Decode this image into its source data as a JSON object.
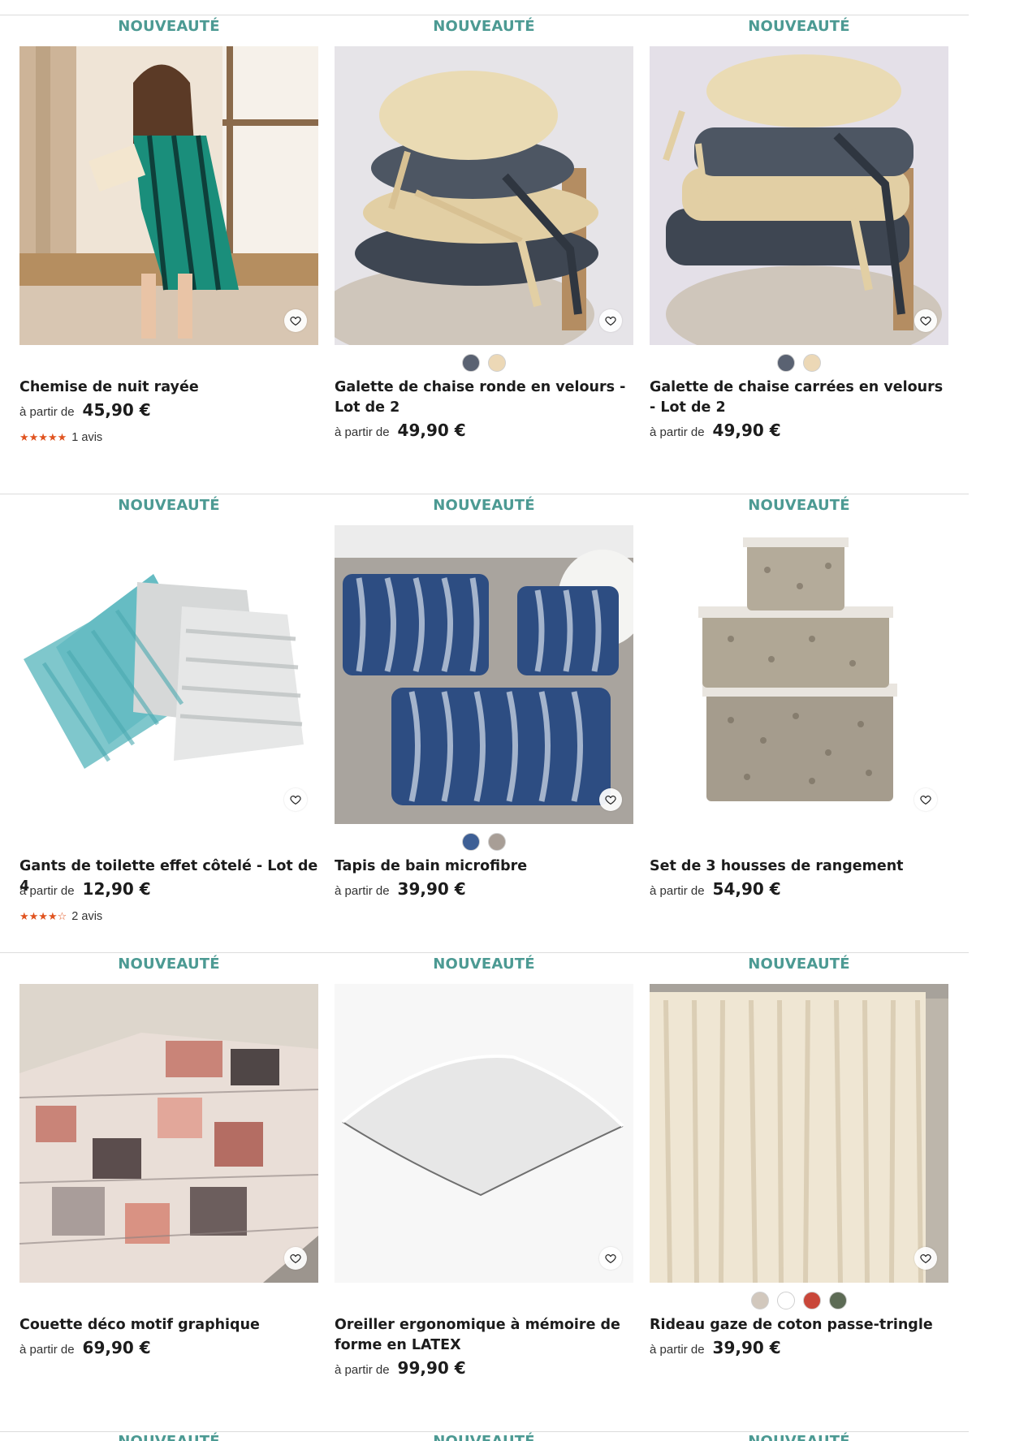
{
  "products": [
    {
      "badge": "NOUVEAUTÉ",
      "title": "Chemise de nuit rayée",
      "price_prefix": "à partir de",
      "price": "45,90 €",
      "rating_stars": "★★★★★",
      "rating_text": "1 avis",
      "image": "woman-nightshirt-photo",
      "swatches": []
    },
    {
      "badge": "NOUVEAUTÉ",
      "title": "Galette de chaise ronde en velours - Lot de 2",
      "price_prefix": "à partir de",
      "price": "49,90 €",
      "image": "round-velvet-cushions-photo",
      "swatches": [
        "#5a6272",
        "#ecd8b6"
      ]
    },
    {
      "badge": "NOUVEAUTÉ",
      "title": "Galette de chaise carrées en velours - Lot de 2",
      "price_prefix": "à partir de",
      "price": "49,90 €",
      "image": "square-velvet-cushions-photo",
      "swatches": [
        "#5a6272",
        "#ecd8b6"
      ]
    },
    {
      "badge": "NOUVEAUTÉ",
      "title": "Gants de toilette effet côtelé - Lot de 4",
      "price_prefix": "à partir de",
      "price": "12,90 €",
      "rating_stars": "★★★★☆",
      "rating_text": "2 avis",
      "image": "ribbed-washcloths-photo",
      "swatches": []
    },
    {
      "badge": "NOUVEAUTÉ",
      "title": "Tapis de bain microfibre",
      "price_prefix": "à partir de",
      "price": "39,90 €",
      "image": "bath-mats-photo",
      "swatches": [
        "#3e5f95",
        "#a89e96"
      ]
    },
    {
      "badge": "NOUVEAUTÉ",
      "title": "Set de 3 housses de rangement",
      "price_prefix": "à partir de",
      "price": "54,90 €",
      "image": "storage-boxes-photo",
      "swatches": []
    },
    {
      "badge": "NOUVEAUTÉ",
      "title": "Couette déco motif graphique",
      "price_prefix": "à partir de",
      "price": "69,90 €",
      "image": "graphic-duvet-photo",
      "swatches": []
    },
    {
      "badge": "NOUVEAUTÉ",
      "title": "Oreiller ergonomique à mémoire de forme en LATEX",
      "price_prefix": "à partir de",
      "price": "99,90 €",
      "image": "memory-foam-pillow-photo",
      "swatches": []
    },
    {
      "badge": "NOUVEAUTÉ",
      "title": "Rideau gaze de coton passe-tringle",
      "price_prefix": "à partir de",
      "price": "39,90 €",
      "image": "cotton-gauze-curtain-photo",
      "swatches": [
        "#d2c8bd",
        "#ffffff",
        "#c9473a",
        "#5d6b55"
      ]
    }
  ],
  "next_row_badges": [
    "NOUVEAUTÉ",
    "NOUVEAUTÉ",
    "NOUVEAUTÉ"
  ],
  "colors": {
    "badge": "#4c9a93",
    "stars": "#e0531f",
    "text": "#1c1c1c",
    "divider": "#dcdcdc"
  },
  "icons": {
    "favorite": "heart-icon"
  }
}
